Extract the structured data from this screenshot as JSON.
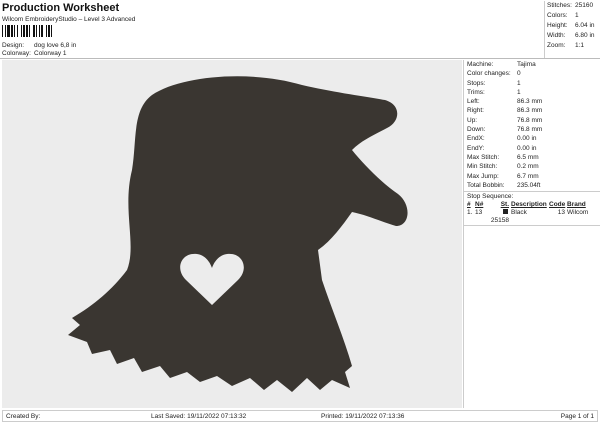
{
  "header": {
    "title": "Production Worksheet",
    "subtitle": "Wilcom EmbroideryStudio – Level 3 Advanced",
    "design_label": "Design:",
    "design_value": "dog love 6,8 in",
    "colorway_label": "Colorway:",
    "colorway_value": "Colorway 1"
  },
  "summary": [
    {
      "k": "Stitches:",
      "v": "25160"
    },
    {
      "k": "Colors:",
      "v": "1"
    },
    {
      "k": "Height:",
      "v": "6.04 in"
    },
    {
      "k": "Width:",
      "v": "6.80 in"
    },
    {
      "k": "Zoom:",
      "v": "1:1"
    }
  ],
  "details": [
    {
      "k": "Machine:",
      "v": "Tajima"
    },
    {
      "k": "Color changes:",
      "v": "0"
    },
    {
      "k": "Stops:",
      "v": "1"
    },
    {
      "k": "Trims:",
      "v": "1"
    },
    {
      "k": "Left:",
      "v": "86.3 mm"
    },
    {
      "k": "Right:",
      "v": "86.3 mm"
    },
    {
      "k": "Up:",
      "v": "76.8 mm"
    },
    {
      "k": "Down:",
      "v": "76.8 mm"
    },
    {
      "k": "EndX:",
      "v": "0.00 in"
    },
    {
      "k": "EndY:",
      "v": "0.00 in"
    },
    {
      "k": "Max Stitch:",
      "v": "6.5 mm"
    },
    {
      "k": "Min Stitch:",
      "v": "0.2 mm"
    },
    {
      "k": "Max Jump:",
      "v": "6.7 mm"
    },
    {
      "k": "Total Bobbin:",
      "v": "235.04ft"
    }
  ],
  "stop_sequence": {
    "label": "Stop Sequence:",
    "headers": [
      "#",
      "N#",
      "St.",
      "Description",
      "Code",
      "Brand"
    ],
    "rows": [
      [
        "1.",
        "13",
        "25158",
        "Black",
        "13",
        "Wilcom"
      ]
    ],
    "swatch_color": "#222222"
  },
  "design_color": "#3a3631",
  "footer": {
    "created_by": "Created By:",
    "last_saved": "Last Saved: 19/11/2022 07:13:32",
    "printed": "Printed: 19/11/2022 07:13:36",
    "page": "Page 1 of 1"
  }
}
